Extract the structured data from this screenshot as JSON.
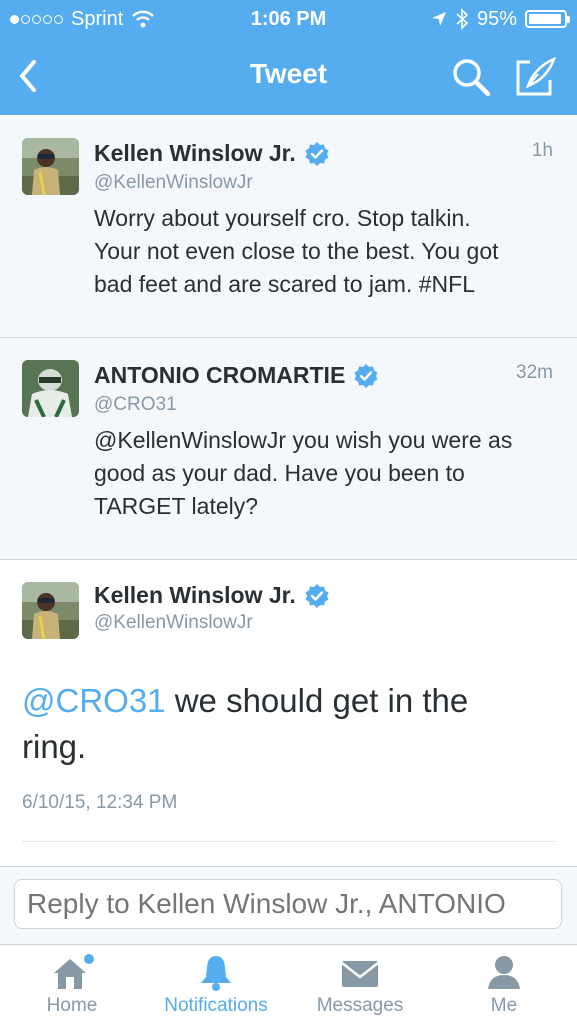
{
  "status_bar": {
    "carrier": "Sprint",
    "time": "1:06 PM",
    "battery": "95%",
    "battery_level": 0.95,
    "signal_bars": 1
  },
  "nav": {
    "title": "Tweet",
    "back_icon": "chevron-left-icon",
    "search_icon": "search-icon",
    "compose_icon": "compose-icon"
  },
  "tweets": [
    {
      "name": "Kellen Winslow Jr.",
      "handle": "@KellenWinslowJr",
      "time": "1h",
      "text_lines": [
        "Worry about yourself cro. Stop talkin.",
        "Your not even close to the best. You got",
        "bad feet and are scared to jam. #NFL"
      ]
    },
    {
      "name": "ANTONIO CROMARTIE",
      "handle": "@CRO31",
      "time": "32m",
      "text_lines": [
        "@KellenWinslowJr you wish you were as",
        "good as your dad. Have you been to",
        "TARGET lately?"
      ]
    }
  ],
  "main_tweet": {
    "name": "Kellen Winslow Jr.",
    "handle": "@KellenWinslowJr",
    "mention": "@CRO31",
    "text_line1": " we should get in the",
    "text_line2": "ring.",
    "date": "6/10/15, 12:34 PM"
  },
  "reply": {
    "placeholder": "Reply to Kellen Winslow Jr., ANTONIO"
  },
  "tabs": [
    {
      "label": "Home",
      "icon": "home-icon",
      "has_badge": true
    },
    {
      "label": "Notifications",
      "icon": "bell-icon",
      "active": true
    },
    {
      "label": "Messages",
      "icon": "envelope-icon"
    },
    {
      "label": "Me",
      "icon": "person-icon"
    }
  ],
  "colors": {
    "brand": "#55acee",
    "text": "#292f33",
    "muted": "#8899a6",
    "context_bg": "#f5f8fa"
  }
}
